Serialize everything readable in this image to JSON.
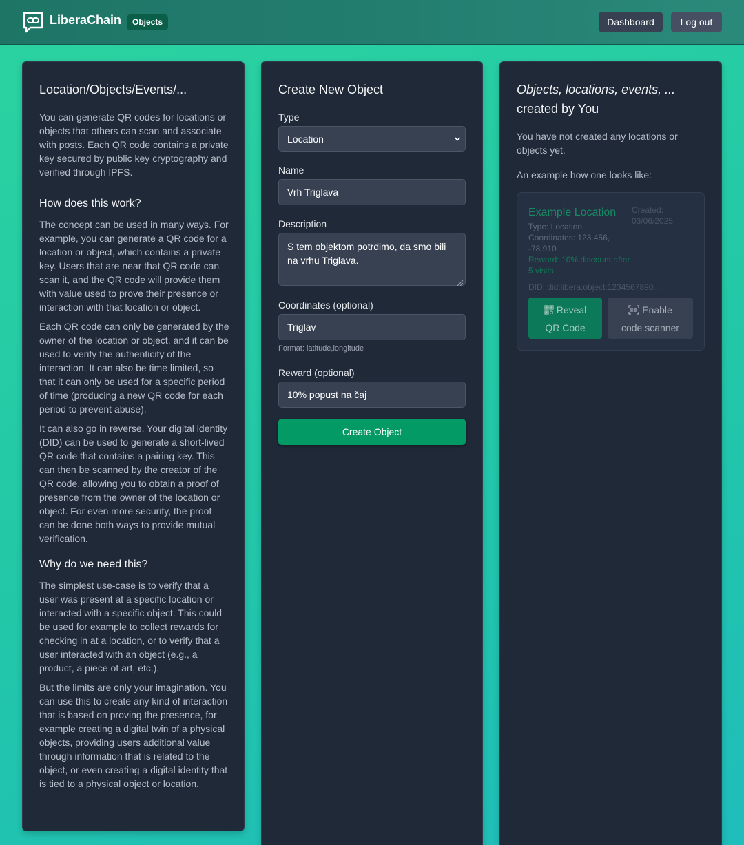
{
  "header": {
    "brand": "LiberaChain",
    "section_badge": "Objects",
    "nav": {
      "dashboard": "Dashboard",
      "logout": "Log out"
    }
  },
  "info": {
    "title": "Location/Objects/Events/...",
    "intro": "You can generate QR codes for locations or objects that others can scan and associate with posts. Each QR code contains a private key secured by public key cryptography and verified through IPFS.",
    "how_title": "How does this work?",
    "how_p1": "The concept can be used in many ways. For example, you can generate a QR code for a location or object, which contains a private key. Users that are near that QR code can scan it, and the QR code will provide them with value used to prove their presence or interaction with that location or object.",
    "how_p2": "Each QR code can only be generated by the owner of the location or object, and it can be used to verify the authenticity of the interaction. It can also be time limited, so that it can only be used for a specific period of time (producing a new QR code for each period to prevent abuse).",
    "how_p3": "It can also go in reverse. Your digital identity (DID) can be used to generate a short-lived QR code that contains a pairing key. This can then be scanned by the creator of the QR code, allowing you to obtain a proof of presence from the owner of the location or object. For even more security, the proof can be done both ways to provide mutual verification.",
    "why_title": "Why do we need this?",
    "why_p1": "The simplest use-case is to verify that a user was present at a specific location or interacted with a specific object. This could be used for example to collect rewards for checking in at a location, or to verify that a user interacted with an object (e.g., a product, a piece of art, etc.).",
    "why_p2": "But the limits are only your imagination. You can use this to create any kind of interaction that is based on proving the presence, for example creating a digital twin of a physical objects, providing users additional value through information that is related to the object, or even creating a digital identity that is tied to a physical object or location."
  },
  "form": {
    "title": "Create New Object",
    "type_label": "Type",
    "type_value": "Location",
    "name_label": "Name",
    "name_value": "Vrh Triglava",
    "description_label": "Description",
    "description_value": "S tem objektom potrdimo, da smo bili na vrhu Triglava.",
    "coordinates_label": "Coordinates (optional)",
    "coordinates_value": "Triglav",
    "coordinates_hint": "Format: latitude,longitude",
    "reward_label": "Reward (optional)",
    "reward_value": "10% popust na čaj",
    "submit_label": "Create Object"
  },
  "created": {
    "title_italic": "Objects, locations, events, ...",
    "title_rest": "created by You",
    "empty_text": "You have not created any locations or objects yet.",
    "example_intro": "An example how one looks like:",
    "example": {
      "name": "Example Location",
      "created_label": "Created:",
      "created_date": "03/06/2025",
      "type_line": "Type: Location",
      "coords_line1": "Coordinates: 123.456,",
      "coords_line2": "-78.910",
      "reward_line1": "Reward: 10% discount after",
      "reward_line2": "5 visits",
      "did": "DID: did:libera:object:1234567890...",
      "reveal_line1": "Reveal",
      "reveal_line2": "QR Code",
      "scanner_line1": "Enable",
      "scanner_line2": "code scanner"
    }
  },
  "icons": {
    "logo": "chat-link-icon",
    "select": "chevron-down-icon",
    "reveal": "qr-code-icon",
    "scanner": "barcode-scan-icon"
  },
  "colors": {
    "accent": "#049a66",
    "card_bg": "#1f2937",
    "header": "#237d6f"
  }
}
